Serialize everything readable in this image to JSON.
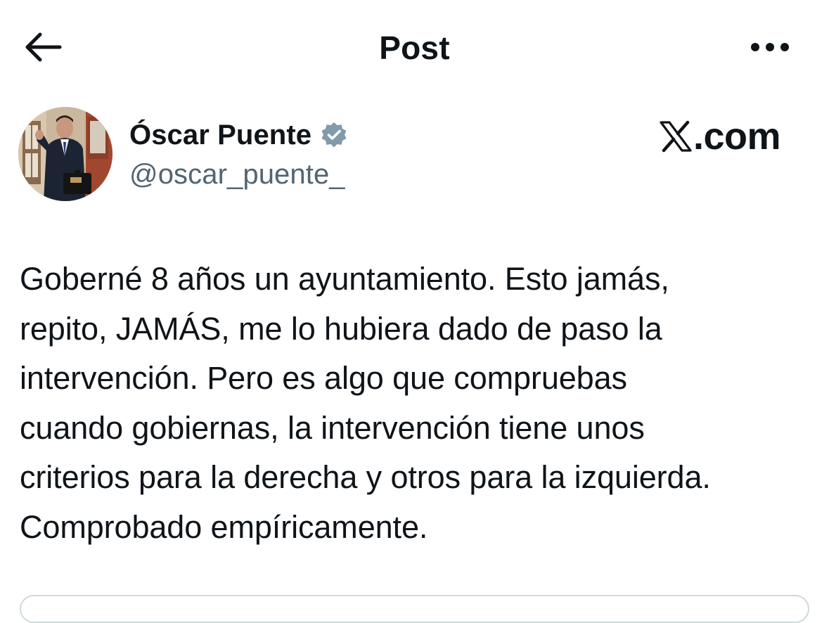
{
  "header": {
    "title": "Post",
    "back_icon": "arrow-left-icon",
    "more_icon": "more-horizontal-icon"
  },
  "author": {
    "name": "Óscar Puente",
    "handle": "@oscar_puente_",
    "verified": true,
    "verified_color": "#829aab"
  },
  "watermark": {
    "logo_icon": "x-logo-icon",
    "text": ".com"
  },
  "post": {
    "lines": [
      "Goberné 8 años un ayuntamiento. Esto jamás,",
      "repito, JAMÁS, me lo hubiera dado de paso la",
      "intervención. Pero es algo que compruebas",
      "cuando gobiernas, la intervención tiene unos",
      "criterios para la derecha y otros para la izquierda.",
      "Comprobado empíricamente."
    ]
  },
  "colors": {
    "text": "#0f1419",
    "secondary": "#536471",
    "border": "#cfd9de"
  }
}
